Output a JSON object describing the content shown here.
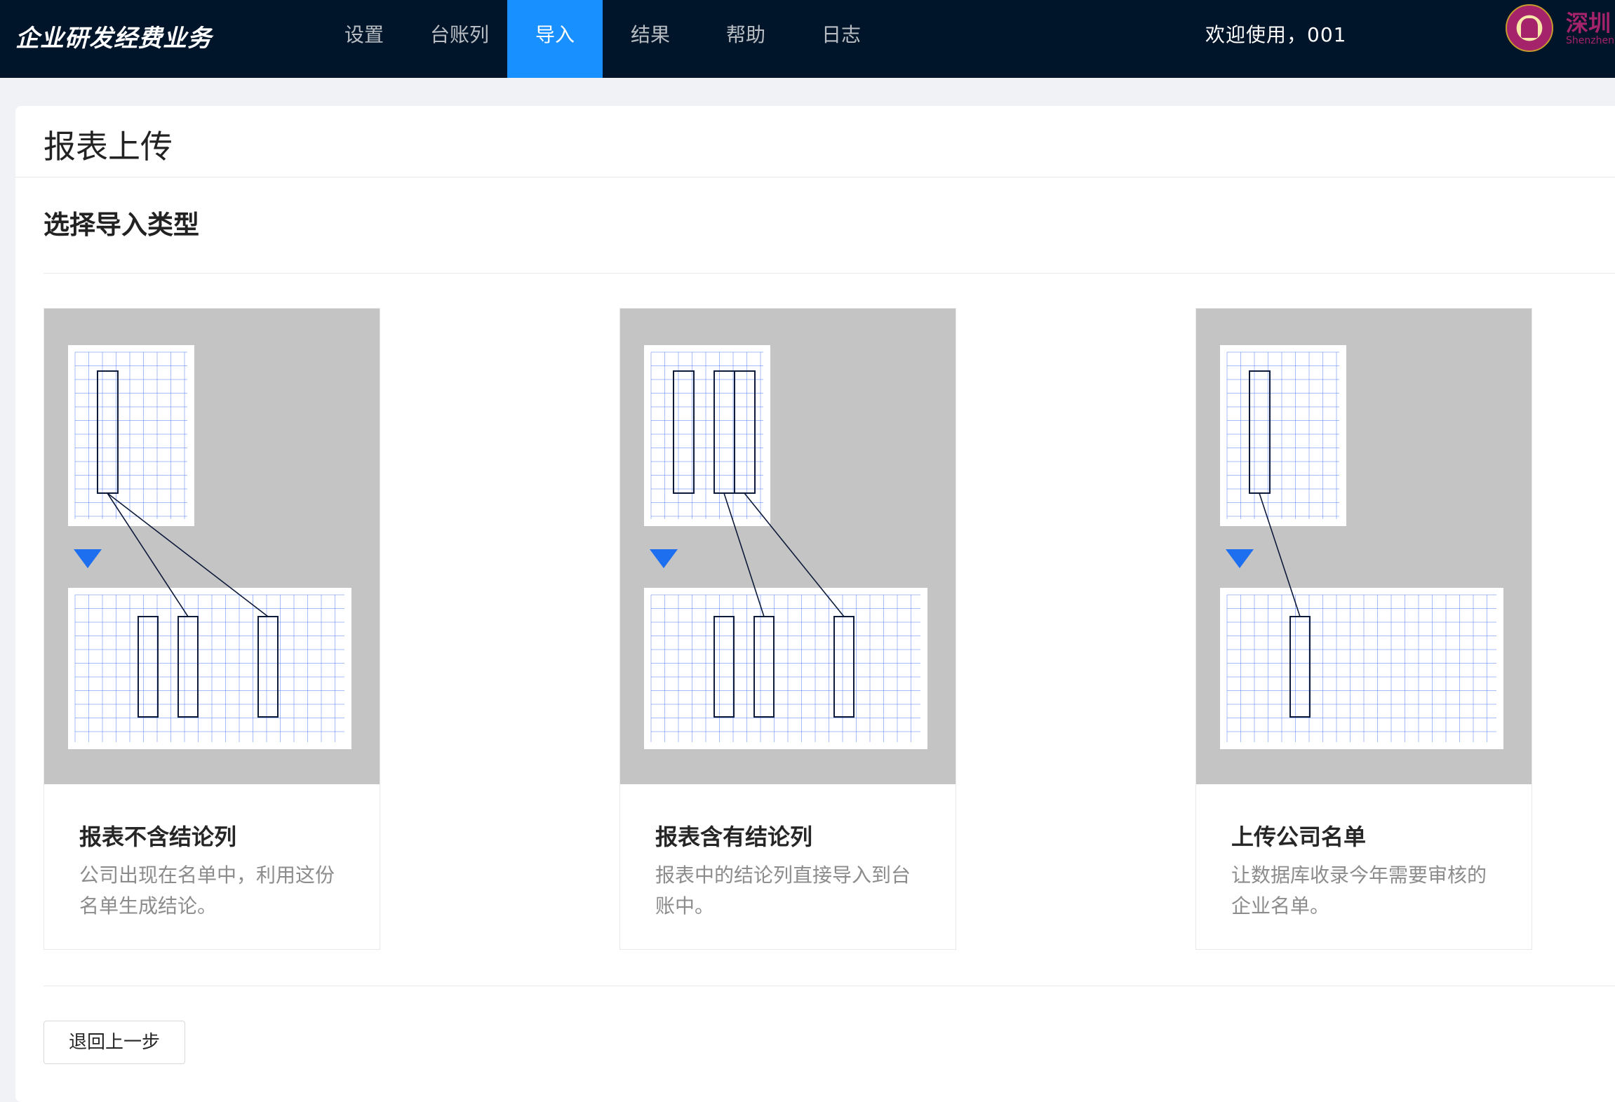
{
  "header": {
    "brand": "企业研发经费业务",
    "nav": [
      {
        "label": "设置"
      },
      {
        "label": "台账列"
      },
      {
        "label": "导入",
        "active": true
      },
      {
        "label": "结果"
      },
      {
        "label": "帮助"
      },
      {
        "label": "日志"
      }
    ],
    "welcome": "欢迎使用，001",
    "logo_text": "深圳",
    "logo_subtext": "Shenzhen"
  },
  "page": {
    "title": "报表上传",
    "section_title": "选择导入类型"
  },
  "cards": [
    {
      "title": "报表不含结论列",
      "description": "公司出现在名单中，利用这份名单生成结论。",
      "illustration": "one-column-to-three-columns"
    },
    {
      "title": "报表含有结论列",
      "description": "报表中的结论列直接导入到台账中。",
      "illustration": "two-columns-to-three-columns"
    },
    {
      "title": "上传公司名单",
      "description": "让数据库收录今年需要审核的企业名单。",
      "illustration": "one-column-to-one-column"
    }
  ],
  "back_button": "退回上一步",
  "colors": {
    "header_bg": "#001529",
    "accent": "#1890ff",
    "card_cover": "#c4c4c4",
    "grid": "#3a6cf0",
    "arrow": "#1e6ff0"
  }
}
